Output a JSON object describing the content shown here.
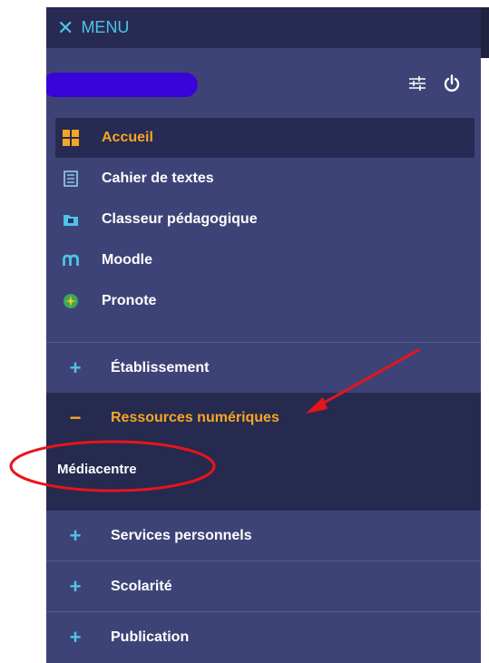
{
  "header": {
    "close_glyph": "✕",
    "title": "MENU"
  },
  "user": {
    "name_redacted": true,
    "icons": [
      "settings-sliders-icon",
      "power-icon"
    ]
  },
  "nav": {
    "items": [
      {
        "label": "Accueil",
        "icon": "grid-icon",
        "active": true
      },
      {
        "label": "Cahier de textes",
        "icon": "notebook-icon",
        "active": false
      },
      {
        "label": "Classeur pédagogique",
        "icon": "folder-icon",
        "active": false
      },
      {
        "label": "Moodle",
        "icon": "moodle-icon",
        "active": false
      },
      {
        "label": "Pronote",
        "icon": "pronote-icon",
        "active": false
      }
    ]
  },
  "sections": [
    {
      "label": "Établissement",
      "sign": "+",
      "expanded": false
    },
    {
      "label": "Ressources numériques",
      "sign": "−",
      "expanded": true,
      "children": [
        "Médiacentre"
      ]
    },
    {
      "label": "Services personnels",
      "sign": "+",
      "expanded": false
    },
    {
      "label": "Scolarité",
      "sign": "+",
      "expanded": false
    },
    {
      "label": "Publication",
      "sign": "+",
      "expanded": false
    }
  ],
  "colors": {
    "panel": "#3e4377",
    "dark": "#272a52",
    "accent_orange": "#f5a623",
    "accent_cyan": "#4fc3e8",
    "annotation_red": "#e8141b"
  }
}
